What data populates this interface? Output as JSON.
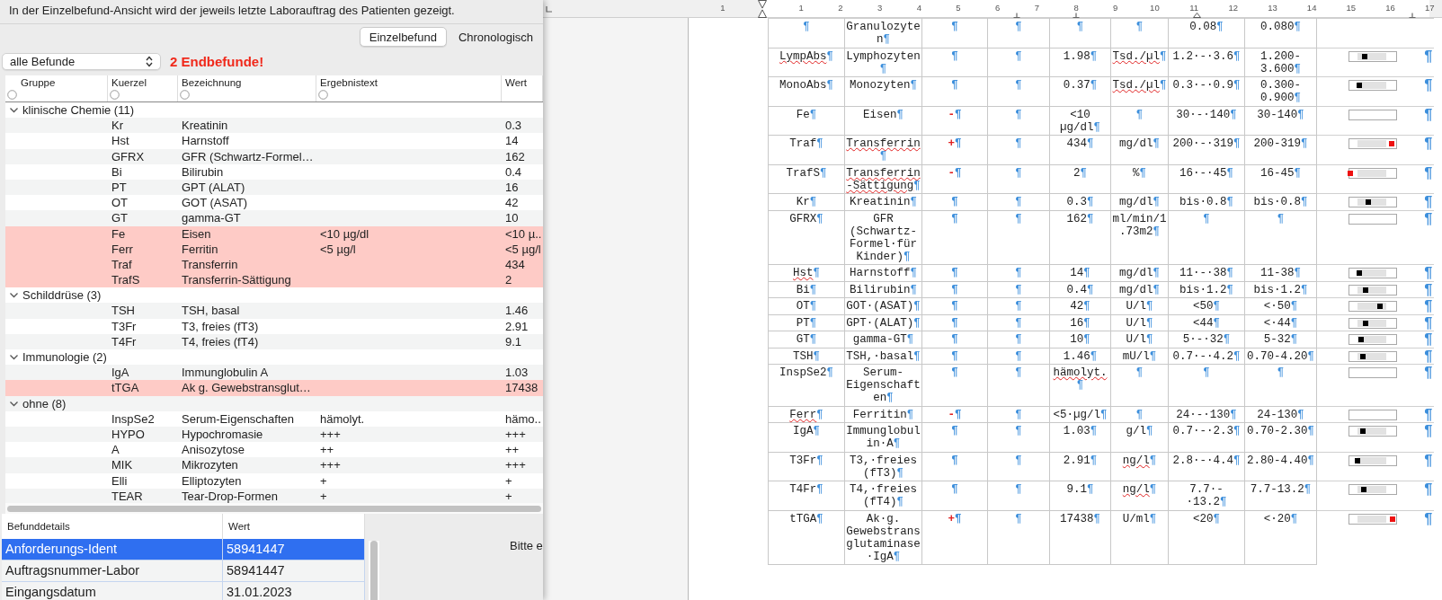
{
  "info_text": "In der Einzelbefund-Ansicht wird der jeweils letzte Laborauftrag des Patienten gezeigt.",
  "view_tabs": [
    {
      "label": "Einzelbefund",
      "selected": true
    },
    {
      "label": "Chronologisch",
      "selected": false
    }
  ],
  "filter": {
    "value": "alle Befunde"
  },
  "alert": "2 Endbefunde!",
  "results_table": {
    "columns": [
      {
        "label": "Gruppe",
        "filterable": true
      },
      {
        "label": "Kuerzel",
        "filterable": true
      },
      {
        "label": "Bezeichnung",
        "filterable": true
      },
      {
        "label": "Ergebnistext",
        "filterable": true
      },
      {
        "label": "Wert",
        "filterable": false
      }
    ],
    "groups": [
      {
        "label": "klinische Chemie (11)",
        "expanded": true,
        "rows": [
          {
            "kuerzel": "Kr",
            "bezeichnung": "Kreatinin",
            "wert": "0.3",
            "abnormal": false
          },
          {
            "kuerzel": "Hst",
            "bezeichnung": "Harnstoff",
            "wert": "14",
            "abnormal": false
          },
          {
            "kuerzel": "GFRX",
            "bezeichnung": "GFR (Schwartz-Formel…",
            "wert": "162",
            "abnormal": false
          },
          {
            "kuerzel": "Bi",
            "bezeichnung": "Bilirubin",
            "wert": "0.4",
            "abnormal": false
          },
          {
            "kuerzel": "PT",
            "bezeichnung": "GPT (ALAT)",
            "wert": "16",
            "abnormal": false
          },
          {
            "kuerzel": "OT",
            "bezeichnung": "GOT (ASAT)",
            "wert": "42",
            "abnormal": false
          },
          {
            "kuerzel": "GT",
            "bezeichnung": "gamma-GT",
            "wert": "10",
            "abnormal": false
          },
          {
            "kuerzel": "Fe",
            "bezeichnung": "Eisen",
            "ergebnistext": "<10 µg/dl",
            "wert": "<10 µ..",
            "abnormal": true
          },
          {
            "kuerzel": "Ferr",
            "bezeichnung": "Ferritin",
            "ergebnistext": "<5 µg/l",
            "wert": "<5 µg/l",
            "abnormal": true
          },
          {
            "kuerzel": "Traf",
            "bezeichnung": "Transferrin",
            "wert": "434",
            "abnormal": true
          },
          {
            "kuerzel": "TrafS",
            "bezeichnung": "Transferrin-Sättigung",
            "wert": "2",
            "abnormal": true
          }
        ]
      },
      {
        "label": "Schilddrüse (3)",
        "expanded": true,
        "rows": [
          {
            "kuerzel": "TSH",
            "bezeichnung": "TSH, basal",
            "wert": "1.46",
            "abnormal": false
          },
          {
            "kuerzel": "T3Fr",
            "bezeichnung": "T3, freies (fT3)",
            "wert": "2.91",
            "abnormal": false
          },
          {
            "kuerzel": "T4Fr",
            "bezeichnung": "T4, freies (fT4)",
            "wert": "9.1",
            "abnormal": false
          }
        ]
      },
      {
        "label": "Immunologie (2)",
        "expanded": true,
        "rows": [
          {
            "kuerzel": "IgA",
            "bezeichnung": "Immunglobulin A",
            "wert": "1.03",
            "abnormal": false
          },
          {
            "kuerzel": "tTGA",
            "bezeichnung": "Ak g. Gewebstransglut…",
            "wert": "17438",
            "abnormal": true
          }
        ]
      },
      {
        "label": "ohne (8)",
        "expanded": true,
        "rows": [
          {
            "kuerzel": "InspSe2",
            "bezeichnung": "Serum-Eigenschaften",
            "ergebnistext": "hämolyt.",
            "wert": "hämo..",
            "abnormal": false
          },
          {
            "kuerzel": "HYPO",
            "bezeichnung": "Hypochromasie",
            "ergebnistext": "+++",
            "wert": "+++",
            "abnormal": false
          },
          {
            "kuerzel": "A",
            "bezeichnung": "Anisozytose",
            "ergebnistext": "++",
            "wert": "++",
            "abnormal": false
          },
          {
            "kuerzel": "MIK",
            "bezeichnung": "Mikrozyten",
            "ergebnistext": "+++",
            "wert": "+++",
            "abnormal": false
          },
          {
            "kuerzel": "Elli",
            "bezeichnung": "Elliptozyten",
            "ergebnistext": "+",
            "wert": "+",
            "abnormal": false
          },
          {
            "kuerzel": "TEAR",
            "bezeichnung": "Tear-Drop-Formen",
            "ergebnistext": "+",
            "wert": "+",
            "abnormal": false
          }
        ]
      }
    ]
  },
  "details_table": {
    "columns": [
      "Befunddetails",
      "Wert"
    ],
    "rows": [
      {
        "label": "Anforderungs-Ident",
        "value": "58941447",
        "selected": true
      },
      {
        "label": "Auftragsnummer-Labor",
        "value": "58941447",
        "selected": false
      },
      {
        "label": "Eingangsdatum",
        "value": "31.01.2023",
        "selected": false
      }
    ]
  },
  "hint_text": "Bitte e",
  "document": {
    "ruler_numbers": [
      "1",
      "1",
      "2",
      "3",
      "4",
      "5",
      "6",
      "7",
      "8",
      "9",
      "10",
      "11",
      "12",
      "13",
      "14",
      "15",
      "16",
      "17"
    ],
    "paragraph_mark": "¶",
    "rows": [
      {
        "bezeichnung": "Granulozyten",
        "range": "0.08",
        "reference": "0.080"
      },
      {
        "kuerzel": "LympAbs",
        "bezeichnung": "Lymphozyten",
        "value": "1.98",
        "unit": "Tsd./µl",
        "range": "1.2·-·3.6",
        "reference": "1.200-3.600",
        "level": 0.33,
        "misspelled": {
          "kuerzel": true,
          "unit": true
        }
      },
      {
        "kuerzel": "MonoAbs",
        "bezeichnung": "Monozyten",
        "value": "0.37",
        "unit": "Tsd./µl",
        "range": "0.3·-·0.9",
        "reference": "0.300-0.900",
        "level": 0.22,
        "misspelled": {
          "unit": true
        }
      },
      {
        "kuerzel": "Fe",
        "bezeichnung": "Eisen",
        "flag": "-",
        "value": "<10 µg/dl",
        "range": "30·-·140",
        "reference": "30-140"
      },
      {
        "kuerzel": "Traf",
        "bezeichnung": "Transferrin",
        "flag": "+",
        "value": "434",
        "unit": "mg/dl",
        "range": "200·-·319",
        "reference": "200-319",
        "level": 0.9,
        "misspelled": {
          "bezeichnung": true
        }
      },
      {
        "kuerzel": "TrafS",
        "bezeichnung": "Transferrin-Sättigung",
        "flag": "-",
        "value": "2",
        "unit": "%",
        "range": "16·-·45",
        "reference": "16-45",
        "level": 0.02,
        "misspelled": {
          "bezeichnung": true
        }
      },
      {
        "kuerzel": "Kr",
        "bezeichnung": "Kreatinin",
        "value": "0.3",
        "unit": "mg/dl",
        "range": "bis·0.8",
        "reference": "bis·0.8",
        "level": 0.4
      },
      {
        "kuerzel": "GFRX",
        "bezeichnung": "GFR (Schwartz-Formel·für Kinder)",
        "value": "162",
        "unit": "ml/min/1.73m2"
      },
      {
        "kuerzel": "Hst",
        "bezeichnung": "Harnstoff",
        "value": "14",
        "unit": "mg/dl",
        "range": "11·-·38",
        "reference": "11-38",
        "level": 0.22,
        "misspelled": {
          "kuerzel": true
        }
      },
      {
        "kuerzel": "Bi",
        "bezeichnung": "Bilirubin",
        "value": "0.4",
        "unit": "mg/dl",
        "range": "bis·1.2",
        "reference": "bis·1.2",
        "level": 0.35
      },
      {
        "kuerzel": "OT",
        "bezeichnung": "GOT·(ASAT)",
        "value": "42",
        "unit": "U/l",
        "range": "<50",
        "reference": "<·50",
        "level": 0.65
      },
      {
        "kuerzel": "PT",
        "bezeichnung": "GPT·(ALAT)",
        "value": "16",
        "unit": "U/l",
        "range": "<44",
        "reference": "<·44",
        "level": 0.35
      },
      {
        "kuerzel": "GT",
        "bezeichnung": "gamma-GT",
        "value": "10",
        "unit": "U/l",
        "range": "5·-·32",
        "reference": "5-32",
        "level": 0.25
      },
      {
        "kuerzel": "TSH",
        "bezeichnung": "TSH,·basal",
        "value": "1.46",
        "unit": "mU/l",
        "range": "0.7·-·4.2",
        "reference": "0.70-4.20",
        "level": 0.28
      },
      {
        "kuerzel": "InspSe2",
        "bezeichnung": "Serum-Eigenschaften",
        "value": "hämolyt.",
        "misspelled": {
          "value": true
        }
      },
      {
        "kuerzel": "Ferr",
        "bezeichnung": "Ferritin",
        "flag": "-",
        "value": "<5·µg/l",
        "range": "24·-·130",
        "reference": "24-130",
        "misspelled": {
          "kuerzel": true
        }
      },
      {
        "kuerzel": "IgA",
        "bezeichnung": "Immunglobulin·A",
        "value": "1.03",
        "unit": "g/l",
        "range": "0.7·-·2.3",
        "reference": "0.70-2.30",
        "level": 0.28
      },
      {
        "kuerzel": "T3Fr",
        "bezeichnung": "T3,·freies (fT3)",
        "value": "2.91",
        "unit": "ng/l",
        "range": "2.8·-·4.4",
        "reference": "2.80-4.40",
        "level": 0.18,
        "misspelled": {
          "unit": true
        }
      },
      {
        "kuerzel": "T4Fr",
        "bezeichnung": "T4,·freies (fT4)",
        "value": "9.1",
        "unit": "ng/l",
        "range": "7.7·-·13.2",
        "reference": "7.7-13.2",
        "level": 0.3,
        "misspelled": {
          "unit": true
        }
      },
      {
        "kuerzel": "tTGA",
        "bezeichnung": "Ak·g. Gewebstransglutaminase·IgA",
        "flag": "+",
        "value": "17438",
        "unit": "U/ml",
        "range": "<20",
        "reference": "<·20",
        "level": 0.92
      }
    ]
  }
}
